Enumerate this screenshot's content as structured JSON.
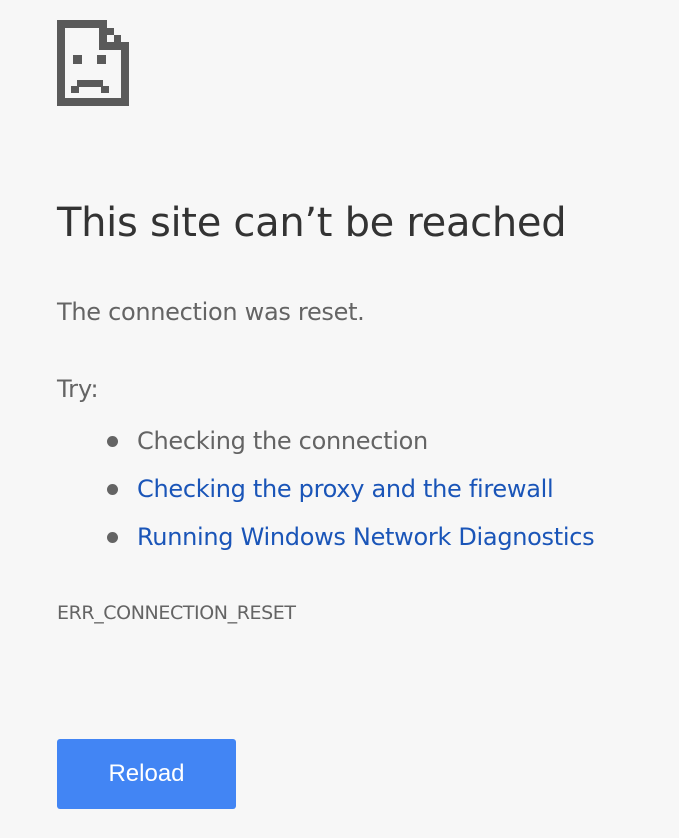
{
  "icon": "sad-page-icon",
  "title": "This site can’t be reached",
  "description": "The connection was reset.",
  "try_label": "Try:",
  "suggestions": [
    {
      "text": "Checking the connection",
      "link": false
    },
    {
      "text": "Checking the proxy and the firewall",
      "link": true
    },
    {
      "text": "Running Windows Network Diagnostics",
      "link": true
    }
  ],
  "error_code": "ERR_CONNECTION_RESET",
  "reload_label": "Reload",
  "colors": {
    "background": "#f7f7f7",
    "title": "#333333",
    "body_text": "#646464",
    "link": "#1a55b8",
    "button": "#4285f4",
    "button_text": "#ffffff",
    "icon": "#5a5a5a"
  }
}
